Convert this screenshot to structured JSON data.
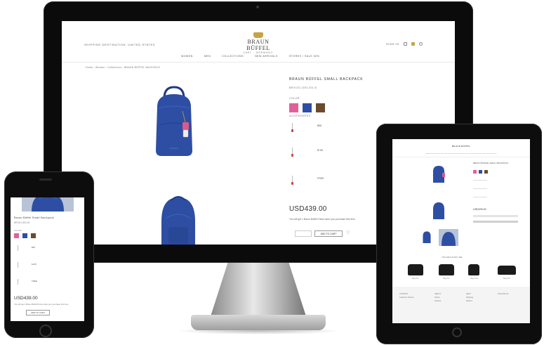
{
  "desktop": {
    "header": {
      "shipping": "SHIPPING DESTINATION: UNITED STATES",
      "brand_name": "BRAUN BÜFFEL",
      "brand_sub": "1887 · GERMANY",
      "sign_in": "SIGN IN",
      "icons": [
        "account-icon",
        "bag-icon",
        "search-icon"
      ]
    },
    "nav": [
      "WOMEN",
      "MEN",
      "COLLECTIONS",
      "NEW ARRIVALS",
      "STORES / SALE 50%"
    ],
    "breadcrumb": "Home › Women › Collections › BRAUN BÜFFEL BACKPACK",
    "product": {
      "title": "BRAUN BÜFFEL SMALL BACKPACK",
      "sku": "BRX2D-GELD5-D",
      "color_label": "COLOR:",
      "colors": [
        "#e0619a",
        "#2d4ea3",
        "#6b4a2e"
      ],
      "accessories_label": "ACCESSORIES",
      "accessories": [
        "$55",
        "$+55",
        "FREE"
      ],
      "price": "USD439.00",
      "note": "You will get 1 Braun Büffel Points when you purchase this item.",
      "add_to_cart": "ADD TO CART",
      "wishlist_icon": "heart-icon"
    }
  },
  "phone": {
    "title": "Braun Büffel Small Backpack",
    "sku": "BRX2D-GELD5",
    "color_label": "COLOR:",
    "accessories": [
      "$55",
      "$+55",
      "FREE"
    ],
    "price": "USD439.00",
    "note": "You will get 1 Braun Büffel Points when you purchase this item.",
    "add_to_cart": "ADD TO CART"
  },
  "tablet": {
    "brand": "BRAUN BÜFFEL",
    "title": "BRAUN BÜFFEL SMALL BACKPACK",
    "price": "USD439.00",
    "recommended_label": "YOU MAY ALSO LIKE",
    "recommended": [
      "Bag One",
      "Bag Two",
      "Bag Three",
      "Bag Four"
    ],
    "footer_cols": [
      [
        "CONTACT",
        "Customer Service"
      ],
      [
        "ABOUT",
        "Stores",
        "Careers"
      ],
      [
        "HELP",
        "Shipping",
        "Returns"
      ],
      [
        "FOLLOW US"
      ]
    ]
  },
  "colors": {
    "bezel": "#0b0b0b",
    "backpack_blue": "#2d4ea3",
    "gold": "#c7a346"
  }
}
